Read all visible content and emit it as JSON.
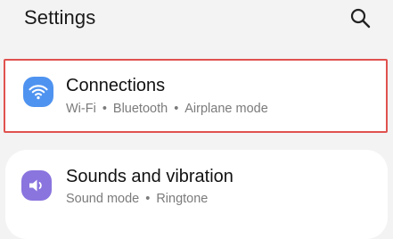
{
  "header": {
    "title": "Settings",
    "search_icon": "search-icon"
  },
  "rows": [
    {
      "title": "Connections",
      "icon": "wifi-icon",
      "icon_color": "#4f93f0",
      "highlighted": true,
      "highlight_color": "#e0524f",
      "subitems": [
        "Wi-Fi",
        "Bluetooth",
        "Airplane mode"
      ]
    },
    {
      "title": "Sounds and vibration",
      "icon": "speaker-icon",
      "icon_color": "#8a74de",
      "highlighted": false,
      "subitems": [
        "Sound mode",
        "Ringtone"
      ]
    }
  ],
  "separator": "•"
}
